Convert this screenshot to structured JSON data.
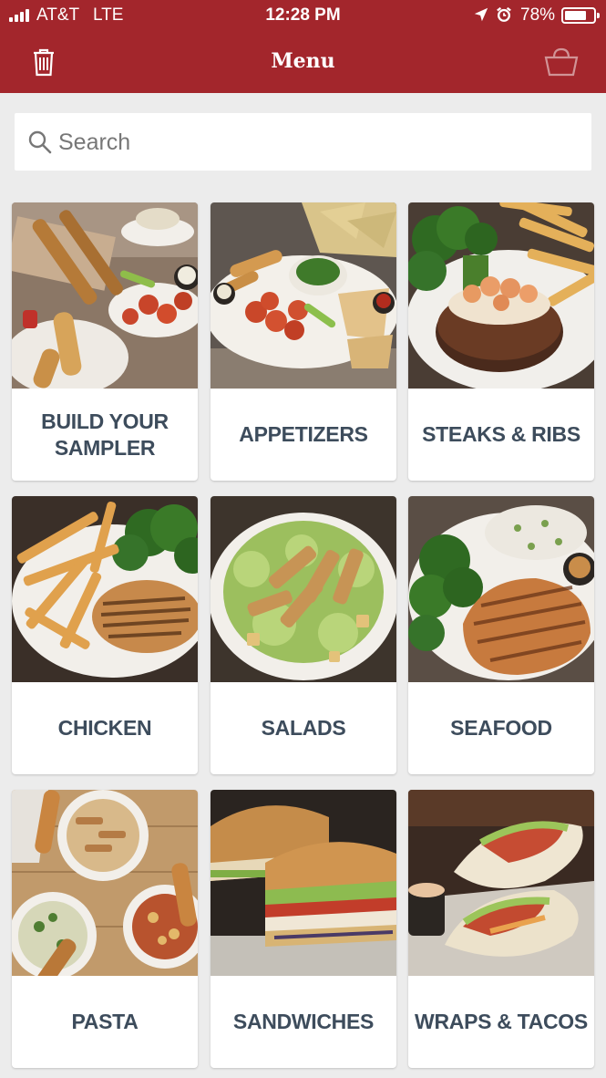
{
  "status_bar": {
    "carrier": "AT&T",
    "network": "LTE",
    "time": "12:28 PM",
    "battery": "78%",
    "battery_level": 0.78
  },
  "header": {
    "title": "Menu",
    "left_icon": "trash-icon",
    "right_icon": "basket-icon"
  },
  "search": {
    "placeholder": "Search",
    "value": ""
  },
  "categories": [
    {
      "label": "BUILD YOUR\nSAMPLER",
      "image": "sampler-photo"
    },
    {
      "label": "APPETIZERS",
      "image": "appetizers-photo"
    },
    {
      "label": "STEAKS & RIBS",
      "image": "steaks-ribs-photo"
    },
    {
      "label": "CHICKEN",
      "image": "chicken-photo"
    },
    {
      "label": "SALADS",
      "image": "salads-photo"
    },
    {
      "label": "SEAFOOD",
      "image": "seafood-photo"
    },
    {
      "label": "PASTA",
      "image": "pasta-photo"
    },
    {
      "label": "SANDWICHES",
      "image": "sandwiches-photo"
    },
    {
      "label": "WRAPS & TACOS",
      "image": "wraps-tacos-photo"
    }
  ],
  "colors": {
    "brand_red": "#a3262c",
    "label_text": "#3d4c5c",
    "background": "#ececec"
  }
}
